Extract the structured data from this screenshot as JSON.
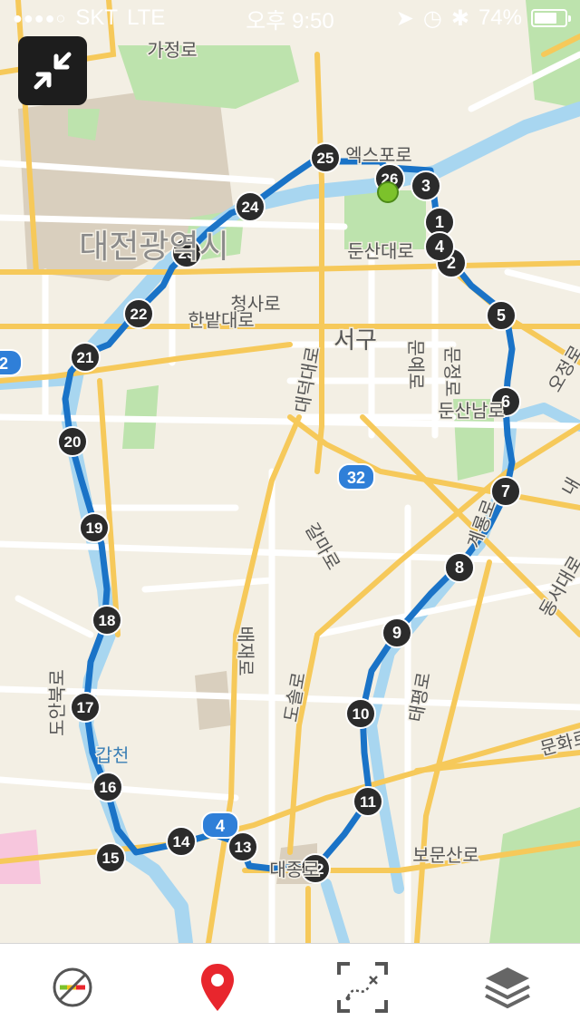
{
  "status": {
    "carrier": "SKT",
    "network": "LTE",
    "time": "오후 9:50",
    "battery": "74%",
    "battery_level": 0.74
  },
  "map": {
    "labels": [
      {
        "id": "gajeong-ro",
        "text": "가정로"
      },
      {
        "id": "daejeon-city",
        "text": "대전광역시"
      },
      {
        "id": "expo-ro",
        "text": "엑스포로"
      },
      {
        "id": "dunsan-daero",
        "text": "둔산대로"
      },
      {
        "id": "cheongsa-ro",
        "text": "청사로"
      },
      {
        "id": "hanbat-daero",
        "text": "한밭대로"
      },
      {
        "id": "seo-gu",
        "text": "서구"
      },
      {
        "id": "daedeok-daero",
        "text": "대덕대로"
      },
      {
        "id": "munye-ro",
        "text": "문예로"
      },
      {
        "id": "munjeong-ro",
        "text": "문정로"
      },
      {
        "id": "dunsan-nam-ro",
        "text": "둔산남로"
      },
      {
        "id": "galma-ro",
        "text": "갈마로"
      },
      {
        "id": "bae-jae-ro",
        "text": "배재로"
      },
      {
        "id": "dosol-ro",
        "text": "도솔로"
      },
      {
        "id": "gyeryong-ro",
        "text": "계룡로"
      },
      {
        "id": "taepyeong-ro",
        "text": "태평로"
      },
      {
        "id": "doanbuk-ro",
        "text": "도안북로"
      },
      {
        "id": "gapcheon",
        "text": "갑천"
      },
      {
        "id": "bomunsan-ro",
        "text": "보문산로"
      },
      {
        "id": "munhwa-ro",
        "text": "문화로"
      },
      {
        "id": "daejong-ro",
        "text": "대종로"
      },
      {
        "id": "ojeong-ro",
        "text": "오정로"
      },
      {
        "id": "dongseo-daero",
        "text": "동서대로"
      },
      {
        "id": "naengni",
        "text": "내"
      }
    ],
    "shields": [
      {
        "id": "route-32",
        "text": "32"
      },
      {
        "id": "route-4",
        "text": "4"
      },
      {
        "id": "route-2",
        "text": "2"
      }
    ],
    "markers": [
      "1",
      "2",
      "3",
      "4",
      "5",
      "6",
      "7",
      "8",
      "9",
      "10",
      "11",
      "12",
      "13",
      "14",
      "15",
      "16",
      "17",
      "18",
      "19",
      "20",
      "21",
      "22",
      "23",
      "24",
      "25",
      "26"
    ],
    "route_color": "#1a73c7",
    "river_color": "#a8d6f0",
    "park_color": "#bde3ad"
  },
  "toolbar": {
    "items": [
      "speed-layer-icon",
      "location-pin-icon",
      "route-select-icon",
      "layers-icon"
    ],
    "pin_color": "#e8262d"
  }
}
